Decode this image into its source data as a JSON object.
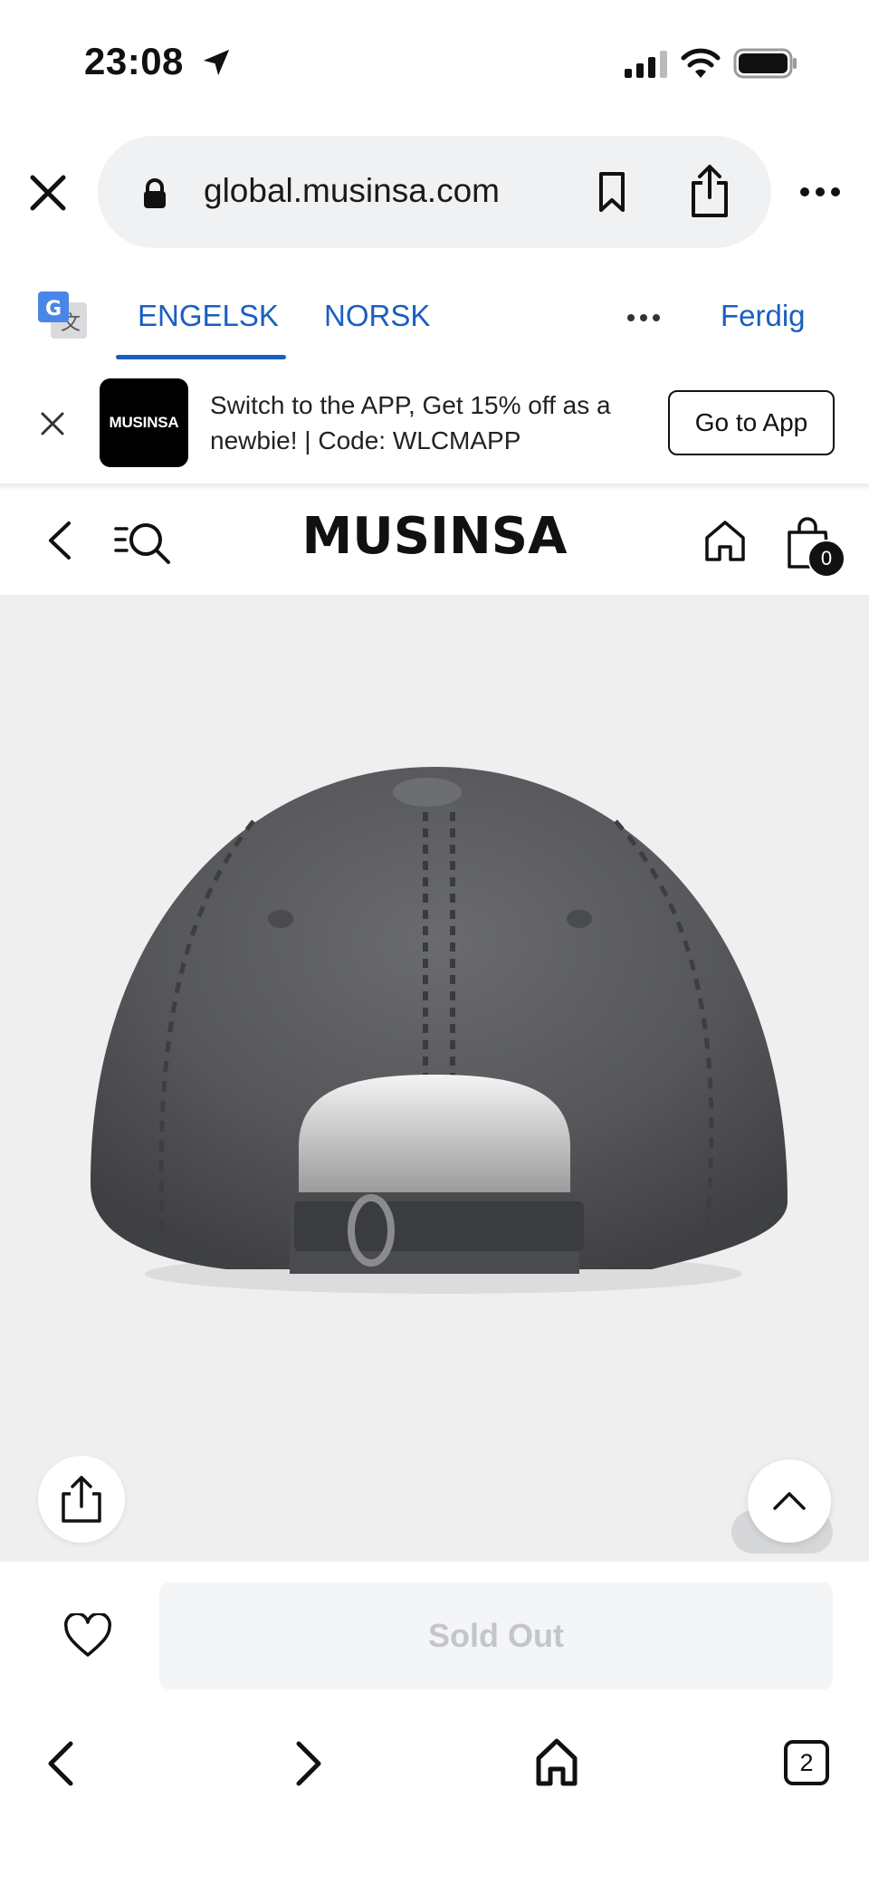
{
  "status_bar": {
    "time": "23:08",
    "icons": [
      "location-arrow-icon",
      "signal-icon",
      "wifi-icon",
      "battery-icon"
    ]
  },
  "browser": {
    "url": "global.musinsa.com",
    "icons": [
      "close-icon",
      "lock-icon",
      "bookmark-icon",
      "share-icon",
      "more-icon"
    ]
  },
  "translate_bar": {
    "tabs": [
      {
        "label": "ENGELSK",
        "active": true
      },
      {
        "label": "NORSK",
        "active": false
      }
    ],
    "done_label": "Ferdig",
    "accent": "#1a5fbf"
  },
  "app_banner": {
    "logo_text": "MUSINSA",
    "message": "Switch to the APP, Get 15% off as a newbie! | Code: WLCMAPP",
    "button_label": "Go to App"
  },
  "site_header": {
    "brand": "MUSINSA",
    "cart_count": "0"
  },
  "product": {
    "image": "washed-gray-baseball-cap-back-view",
    "background": "#efefef"
  },
  "purchase_bar": {
    "button_label": "Sold Out"
  },
  "bottom_nav": {
    "tab_count": "2"
  }
}
